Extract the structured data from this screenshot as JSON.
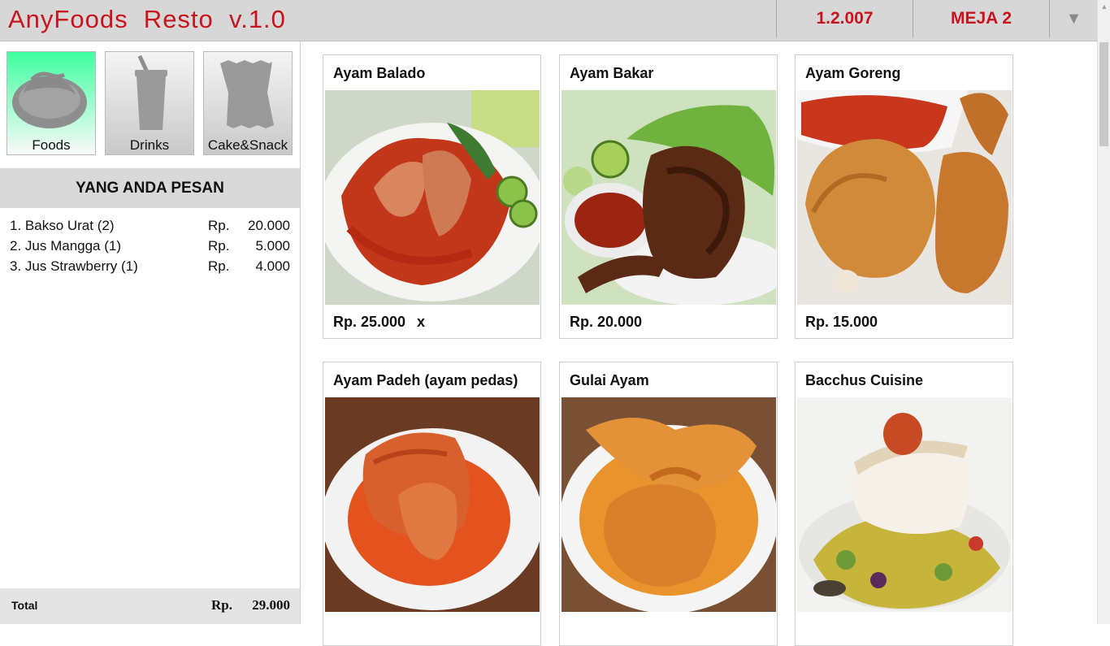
{
  "header": {
    "title": "AnyFoods  Resto  v.1.0",
    "version": "1.2.007",
    "table": "MEJA 2",
    "dropdown_icon": "▼"
  },
  "categories": [
    {
      "label": "Foods",
      "icon": "plate-icon",
      "active": true
    },
    {
      "label": "Drinks",
      "icon": "cup-icon",
      "active": false
    },
    {
      "label": "Cake&Snack",
      "icon": "snack-bag-icon",
      "active": false
    }
  ],
  "order": {
    "heading": "YANG ANDA PESAN",
    "items": [
      {
        "name": "1. Bakso Urat (2)",
        "currency": "Rp.",
        "amount": "20.000"
      },
      {
        "name": "2. Jus Mangga (1)",
        "currency": "Rp.",
        "amount": "5.000"
      },
      {
        "name": "3. Jus Strawberry (1)",
        "currency": "Rp.",
        "amount": "4.000"
      }
    ],
    "total_label": "Total",
    "total_currency": "Rp.",
    "total_amount": "29.000"
  },
  "products": [
    {
      "name": "Ayam Balado",
      "price": "Rp. 25.000",
      "remove": "x",
      "image": "ayam-balado-photo"
    },
    {
      "name": "Ayam Bakar",
      "price": "Rp. 20.000",
      "remove": "",
      "image": "ayam-bakar-photo"
    },
    {
      "name": "Ayam Goreng",
      "price": "Rp. 15.000",
      "remove": "",
      "image": "ayam-goreng-photo"
    },
    {
      "name": "Ayam Padeh (ayam pedas)",
      "price": "",
      "remove": "",
      "image": "ayam-padeh-photo"
    },
    {
      "name": "Gulai Ayam",
      "price": "",
      "remove": "",
      "image": "gulai-ayam-photo"
    },
    {
      "name": "Bacchus Cuisine",
      "price": "",
      "remove": "",
      "image": "bacchus-cuisine-photo"
    }
  ],
  "colors": {
    "brand_red": "#c8141e",
    "active_category": "#3ffea0",
    "header_bg": "#d7d7d7"
  }
}
